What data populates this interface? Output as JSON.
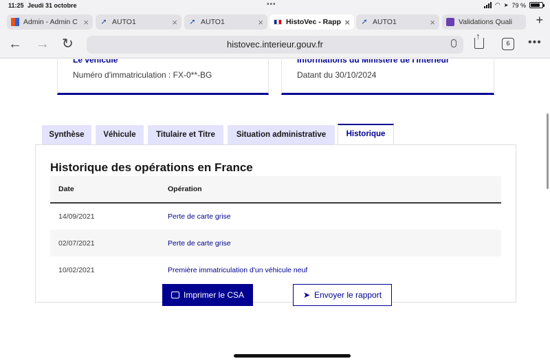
{
  "status_bar": {
    "time": "11:25",
    "date": "Jeudi 31 octobre",
    "battery": "79 %"
  },
  "browser_tabs": [
    {
      "label": "Admin - Admin C",
      "favicon": "admin-favicon"
    },
    {
      "label": "AUTO1",
      "favicon": "auto1-favicon"
    },
    {
      "label": "AUTO1",
      "favicon": "auto1-favicon"
    },
    {
      "label": "HistoVec - Rapp",
      "favicon": "french-flag-favicon",
      "active": true
    },
    {
      "label": "AUTO1",
      "favicon": "auto1-favicon"
    },
    {
      "label": "Validations Quali",
      "favicon": "validations-favicon"
    }
  ],
  "address_bar": {
    "url": "histovec.interieur.gouv.fr",
    "tab_count": "6"
  },
  "cards": {
    "vehicle": {
      "title": "Le véhicule",
      "text": "Numéro d'immatriculation : FX-0**-BG"
    },
    "ministry": {
      "title": "Informations du Ministère de l'Intérieur",
      "text": "Datant du 30/10/2024"
    }
  },
  "tabs": [
    {
      "label": "Synthèse"
    },
    {
      "label": "Véhicule"
    },
    {
      "label": "Titulaire et Titre"
    },
    {
      "label": "Situation administrative"
    },
    {
      "label": "Historique",
      "active": true
    }
  ],
  "history": {
    "title": "Historique des opérations en France",
    "columns": {
      "date": "Date",
      "operation": "Opération"
    },
    "rows": [
      {
        "date": "14/09/2021",
        "operation": "Perte de carte grise"
      },
      {
        "date": "02/07/2021",
        "operation": "Perte de carte grise"
      },
      {
        "date": "10/02/2021",
        "operation": "Première immatriculation d'un véhicule neuf"
      }
    ]
  },
  "actions": {
    "print": "Imprimer le CSA",
    "send": "Envoyer le rapport"
  },
  "colors": {
    "primary": "#000091",
    "tab_bg": "#e3e3fd",
    "row_alt": "#f6f6f6"
  }
}
